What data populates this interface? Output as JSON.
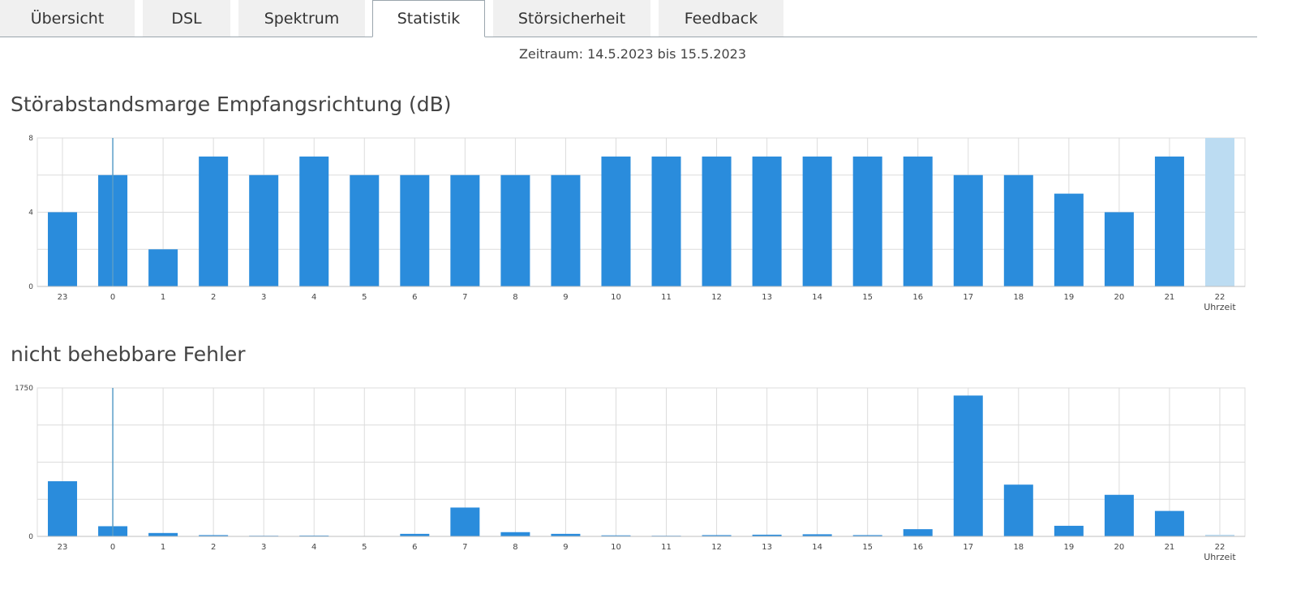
{
  "tabs": [
    {
      "label": "Übersicht",
      "active": false
    },
    {
      "label": "DSL",
      "active": false
    },
    {
      "label": "Spektrum",
      "active": false
    },
    {
      "label": "Statistik",
      "active": true
    },
    {
      "label": "Störsicherheit",
      "active": false
    },
    {
      "label": "Feedback",
      "active": false
    }
  ],
  "period": "Zeitraum: 14.5.2023 bis 15.5.2023",
  "colors": {
    "bar": "#2a8cdc",
    "bar_highlight": "#bcdcf2",
    "grid": "#dcdcdc",
    "marker": "#5a9ec8"
  },
  "chart_data": [
    {
      "type": "bar",
      "title": "Störabstandsmarge Empfangsrichtung (dB)",
      "xlabel": "Uhrzeit",
      "ylabel": "",
      "categories": [
        "23",
        "0",
        "1",
        "2",
        "3",
        "4",
        "5",
        "6",
        "7",
        "8",
        "9",
        "10",
        "11",
        "12",
        "13",
        "14",
        "15",
        "16",
        "17",
        "18",
        "19",
        "20",
        "21",
        "22"
      ],
      "values": [
        4,
        6,
        2,
        7,
        6,
        7,
        6,
        6,
        6,
        6,
        6,
        7,
        7,
        7,
        7,
        7,
        7,
        7,
        6,
        6,
        5,
        4,
        7,
        8
      ],
      "highlight_index": 23,
      "marker_category": "0",
      "ylim": [
        0,
        8
      ],
      "yticks": [
        0,
        4,
        8
      ],
      "grid": true
    },
    {
      "type": "bar",
      "title": "nicht behebbare Fehler",
      "xlabel": "Uhrzeit",
      "ylabel": "",
      "categories": [
        "23",
        "0",
        "1",
        "2",
        "3",
        "4",
        "5",
        "6",
        "7",
        "8",
        "9",
        "10",
        "11",
        "12",
        "13",
        "14",
        "15",
        "16",
        "17",
        "18",
        "19",
        "20",
        "21",
        "22"
      ],
      "values": [
        650,
        120,
        40,
        15,
        8,
        10,
        5,
        30,
        340,
        50,
        30,
        12,
        8,
        15,
        20,
        25,
        15,
        85,
        1660,
        610,
        125,
        490,
        300,
        20
      ],
      "highlight_index": 23,
      "marker_category": "0",
      "ylim": [
        0,
        1750
      ],
      "yticks": [
        0,
        1750
      ],
      "grid": true
    }
  ]
}
